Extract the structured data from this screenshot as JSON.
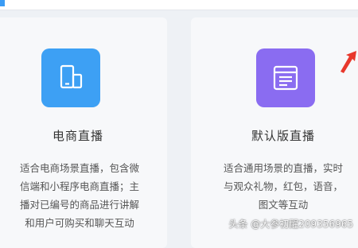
{
  "cards": [
    {
      "title": "电商直播",
      "icon": "mobile-devices-icon",
      "icon_color": "#3da0f4",
      "desc_lines": [
        "适合电商场景直播，包含微",
        "信端和小程序电商直播；主",
        "播对已编号的商品进行讲解",
        "和用户可购买和聊天互动"
      ]
    },
    {
      "title": "默认版直播",
      "icon": "browser-window-icon",
      "icon_color": "#8a6cf1",
      "desc_lines": [
        "适合通用场景的直播，实时",
        "与观众礼物，红包，语音，",
        "图文等互动"
      ]
    }
  ],
  "accent_color": "#3b9cf5",
  "annotation_color": "#e8382c",
  "watermark": "头条 @大参初醒209356965"
}
